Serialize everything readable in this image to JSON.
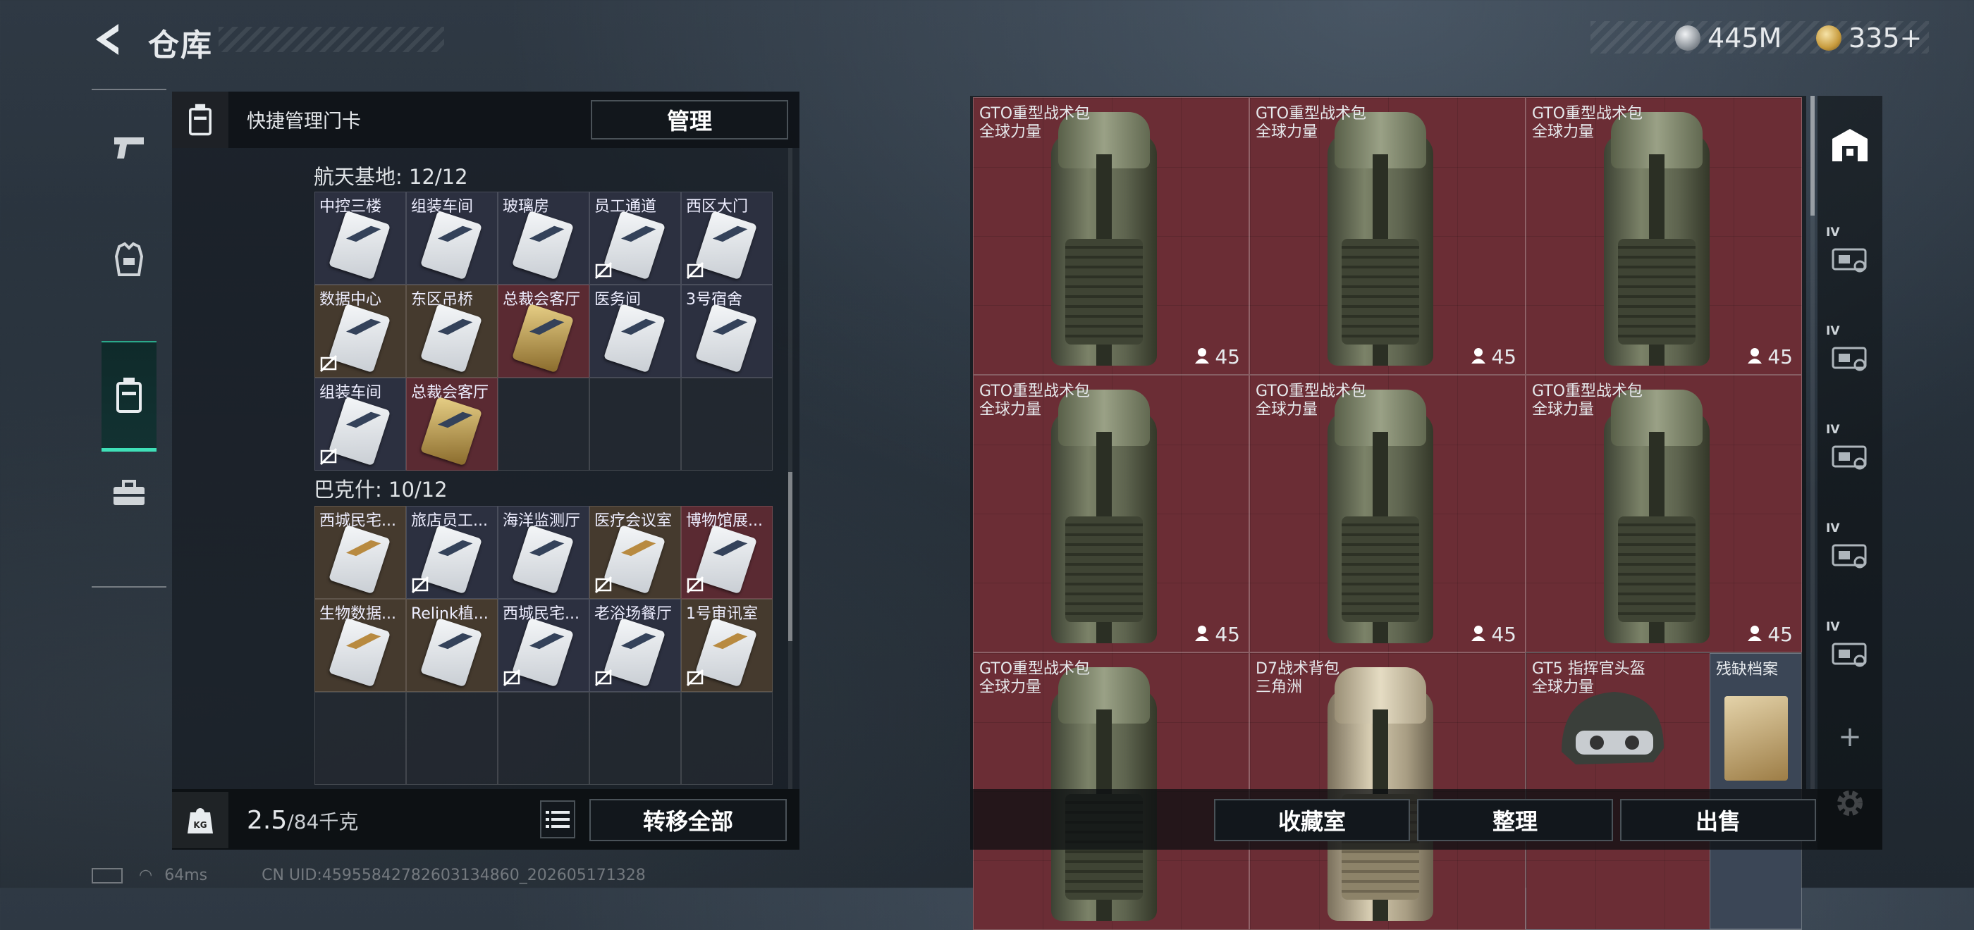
{
  "header": {
    "title": "仓库",
    "currency1": "445M",
    "currency2": "335+",
    "currency1_icon": "silver-coin-icon",
    "currency2_icon": "gold-triangle-coin-icon"
  },
  "left_nav": [
    {
      "icon": "pistol-icon"
    },
    {
      "icon": "armor-vest-icon"
    },
    {
      "icon": "keycard-holder-icon",
      "active": true
    },
    {
      "icon": "toolbox-icon"
    }
  ],
  "quick_manage": {
    "label": "快捷管理门卡",
    "button": "管理"
  },
  "sections": [
    {
      "title": "航天基地: 12/12",
      "cells": [
        {
          "name": "中控三楼",
          "bg": "w",
          "card": "white",
          "nolink": false
        },
        {
          "name": "组装车间",
          "bg": "w",
          "card": "white",
          "nolink": false
        },
        {
          "name": "玻璃房",
          "bg": "w",
          "card": "white",
          "nolink": false
        },
        {
          "name": "员工通道",
          "bg": "w",
          "card": "white",
          "nolink": true
        },
        {
          "name": "西区大门",
          "bg": "w",
          "card": "white",
          "nolink": true
        },
        {
          "name": "数据中心",
          "bg": "b",
          "card": "white",
          "nolink": true
        },
        {
          "name": "东区吊桥",
          "bg": "b",
          "card": "white",
          "nolink": false
        },
        {
          "name": "总裁会客厅",
          "bg": "r",
          "card": "gold",
          "nolink": false
        },
        {
          "name": "医务间",
          "bg": "w",
          "card": "white",
          "nolink": false
        },
        {
          "name": "3号宿舍",
          "bg": "w",
          "card": "white",
          "nolink": false
        },
        {
          "name": "组装车间",
          "bg": "w",
          "card": "white",
          "nolink": true
        },
        {
          "name": "总裁会客厅",
          "bg": "r",
          "card": "gold",
          "nolink": false
        }
      ]
    },
    {
      "title": "巴克什: 10/12",
      "cells": [
        {
          "name": "西城民宅...",
          "bg": "b",
          "card": "tan",
          "nolink": false
        },
        {
          "name": "旅店员工...",
          "bg": "w",
          "card": "white",
          "nolink": true
        },
        {
          "name": "海洋监测厅",
          "bg": "w",
          "card": "white",
          "nolink": false
        },
        {
          "name": "医疗会议室",
          "bg": "b",
          "card": "tan",
          "nolink": true
        },
        {
          "name": "博物馆展...",
          "bg": "r",
          "card": "white",
          "nolink": true
        },
        {
          "name": "生物数据...",
          "bg": "b",
          "card": "tan",
          "nolink": false
        },
        {
          "name": "Relink植...",
          "bg": "b",
          "card": "white",
          "nolink": false
        },
        {
          "name": "西城民宅...",
          "bg": "w",
          "card": "white",
          "nolink": true
        },
        {
          "name": "老浴场餐厅",
          "bg": "w",
          "card": "white",
          "nolink": true
        },
        {
          "name": "1号审讯室",
          "bg": "b",
          "card": "tan",
          "nolink": true
        }
      ]
    }
  ],
  "weight": {
    "current": "2.5",
    "max": "/84千克"
  },
  "transfer_all": "转移全部",
  "storage_items": [
    {
      "name": "GTO重型战术包",
      "sub": "全球力量",
      "count": "45",
      "type": "bag"
    },
    {
      "name": "GTO重型战术包",
      "sub": "全球力量",
      "count": "45",
      "type": "bag"
    },
    {
      "name": "GTO重型战术包",
      "sub": "全球力量",
      "count": "45",
      "type": "bag"
    },
    {
      "name": "GTO重型战术包",
      "sub": "全球力量",
      "count": "45",
      "type": "bag"
    },
    {
      "name": "GTO重型战术包",
      "sub": "全球力量",
      "count": "45",
      "type": "bag"
    },
    {
      "name": "GTO重型战术包",
      "sub": "全球力量",
      "count": "45",
      "type": "bag"
    },
    {
      "name": "GTO重型战术包",
      "sub": "全球力量",
      "count": "",
      "type": "bag"
    },
    {
      "name": "D7战术背包",
      "sub": "三角洲",
      "count": "",
      "type": "tanbag"
    }
  ],
  "split_slot": {
    "left_name": "GT5 指挥官头盔",
    "left_sub": "全球力量",
    "right_name": "残缺档案"
  },
  "right_rail": {
    "tier_label": "IV"
  },
  "bottom_actions": {
    "collection": "收藏室",
    "organize": "整理",
    "sell": "出售"
  },
  "status": {
    "ping": "64ms",
    "uid": "CN UID:45955842782603134860_202605171328"
  },
  "colors": {
    "accent": "#3fe0b8",
    "slot_red": "#6b2d35"
  }
}
